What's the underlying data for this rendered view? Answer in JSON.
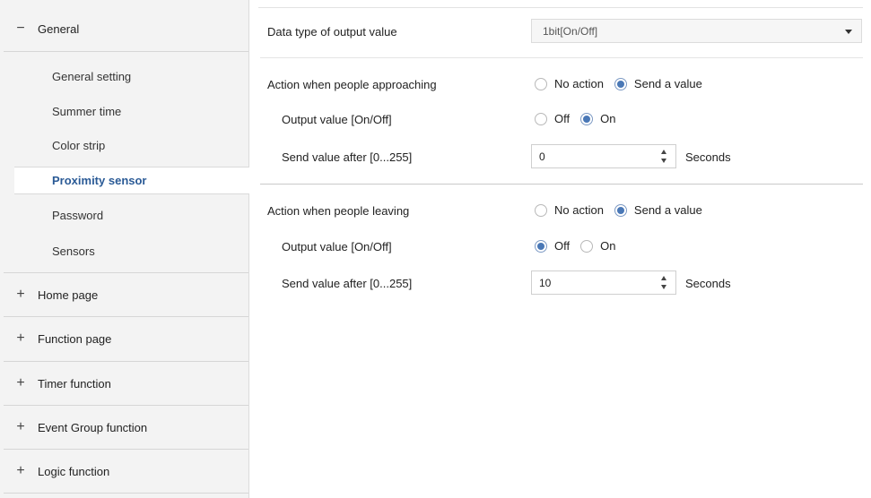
{
  "sidebar": {
    "general": {
      "sign": "−",
      "label": "General"
    },
    "sub_items": [
      {
        "label": "General setting"
      },
      {
        "label": "Summer time"
      },
      {
        "label": "Color strip"
      },
      {
        "label": "Proximity sensor"
      },
      {
        "label": "Password"
      },
      {
        "label": "Sensors"
      }
    ],
    "sections": [
      {
        "sign": "+",
        "label": "Home page"
      },
      {
        "sign": "+",
        "label": "Function page"
      },
      {
        "sign": "+",
        "label": "Timer function"
      },
      {
        "sign": "+",
        "label": "Event Group function"
      },
      {
        "sign": "+",
        "label": "Logic function"
      }
    ]
  },
  "main": {
    "data_type": {
      "label": "Data type of output value",
      "value": "1bit[On/Off]"
    },
    "approaching": {
      "label": "Action when people approaching",
      "options": [
        "No action",
        "Send a value"
      ],
      "selected": "Send a value",
      "output_label": "Output value [On/Off]",
      "output_options": [
        "Off",
        "On"
      ],
      "output_selected": "On",
      "send_label": "Send value after [0...255]",
      "send_value": "0",
      "unit": "Seconds"
    },
    "leaving": {
      "label": "Action when people leaving",
      "options": [
        "No action",
        "Send a value"
      ],
      "selected": "Send a value",
      "output_label": "Output value [On/Off]",
      "output_options": [
        "Off",
        "On"
      ],
      "output_selected": "Off",
      "send_label": "Send value after [0...255]",
      "send_value": "10",
      "unit": "Seconds"
    }
  },
  "colors": {
    "active_item": "#2a5a96",
    "radio_checked": "#4a78b6",
    "sidebar_bg": "#f3f3f3"
  }
}
